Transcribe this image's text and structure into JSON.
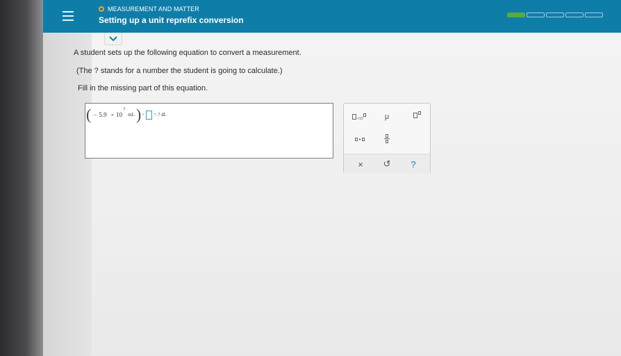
{
  "header": {
    "topic": "MEASUREMENT AND MATTER",
    "title": "Setting up a unit reprefix conversion",
    "progress": {
      "total_segments": 5,
      "filled_segments": 1,
      "fill_color": "#5aaa3c"
    },
    "bar_color": "#0e7ea9"
  },
  "question": {
    "line1": "A student sets up the following equation to convert a measurement.",
    "line2": "(The ? stands for a number the student is going to calculate.)",
    "line3": "Fill in the missing part of this equation."
  },
  "equation": {
    "sign": "−",
    "coefficient": "5.9",
    "times": "×",
    "base": "10",
    "exponent": "3",
    "unit": "mL",
    "dot": "·",
    "rhs": "= ? dL"
  },
  "palette": {
    "x10_label": "×10",
    "mu": "μ",
    "clear": "×",
    "undo": "↺",
    "help": "?"
  }
}
